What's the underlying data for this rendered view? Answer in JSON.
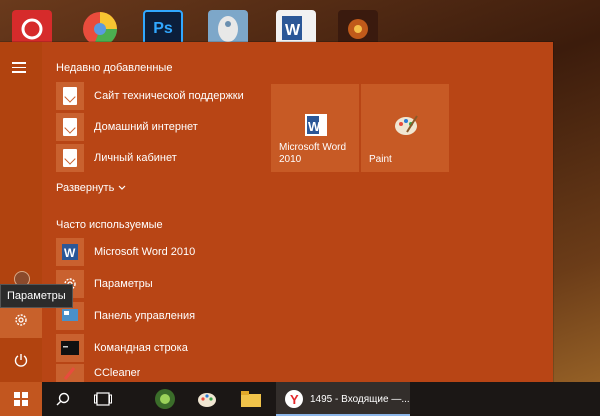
{
  "colors": {
    "accent": "#b84515",
    "tile": "#c75a25",
    "taskbar": "#1b1715"
  },
  "desktop": {
    "icons": [
      "camera-app-icon",
      "chrome-like-app-icon",
      "photoshop-icon",
      "paint-brush-icon",
      "word-document-icon",
      "game-app-icon"
    ],
    "photoshop_label": "Ps"
  },
  "start_menu": {
    "recent_title": "Недавно добавленные",
    "recent_items": [
      {
        "label": "Сайт технической поддержки",
        "icon": "document-icon"
      },
      {
        "label": "Домашний интернет",
        "icon": "document-icon"
      },
      {
        "label": "Личный кабинет",
        "icon": "document-icon"
      }
    ],
    "expand_label": "Развернуть",
    "frequent_title": "Часто используемые",
    "frequent_items": [
      {
        "label": "Microsoft Word 2010",
        "icon": "word-icon"
      },
      {
        "label": "Параметры",
        "icon": "gear-icon"
      },
      {
        "label": "Панель управления",
        "icon": "control-panel-icon"
      },
      {
        "label": "Командная строка",
        "icon": "cmd-icon"
      },
      {
        "label": "CCleaner",
        "icon": "ccleaner-icon"
      }
    ],
    "tiles": [
      {
        "label": "Microsoft Word 2010",
        "icon": "word-icon"
      },
      {
        "label": "Paint",
        "icon": "paint-palette-icon"
      }
    ]
  },
  "tooltip": "Параметры",
  "taskbar": {
    "apps": [
      "search-icon",
      "task-view-icon",
      "alien-app-icon",
      "paint-palette-icon",
      "file-explorer-icon"
    ],
    "mail_window_label": "1495 - Входящие —..."
  }
}
